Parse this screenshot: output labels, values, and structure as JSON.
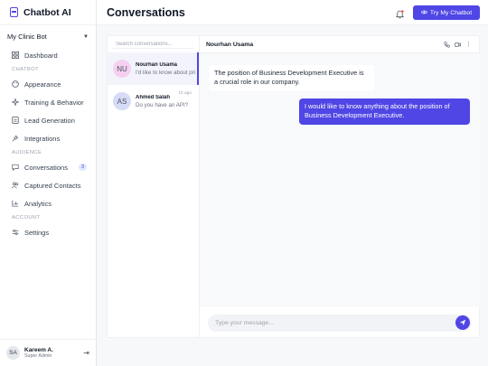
{
  "app": {
    "name": "Chatbot AI",
    "accent": "#4f46e5"
  },
  "sidebar": {
    "bot_select": "My Clinic Bot",
    "dashboard": {
      "label": "Dashboard",
      "icon": "grid-icon"
    },
    "sections": [
      {
        "label": "CHATBOT"
      },
      {
        "label": "AUDIENCE"
      },
      {
        "label": "ACCOUNT"
      }
    ],
    "chatbot_items": [
      {
        "label": "Appearance",
        "icon": "palette-icon"
      },
      {
        "label": "Training & Behavior",
        "icon": "sparkle-icon"
      },
      {
        "label": "Lead Generation",
        "icon": "form-icon"
      },
      {
        "label": "Integrations",
        "icon": "plug-icon"
      }
    ],
    "audience_items": [
      {
        "label": "Conversations",
        "icon": "chat-icon",
        "badge": "3"
      },
      {
        "label": "Captured Contacts",
        "icon": "users-icon"
      },
      {
        "label": "Analytics",
        "icon": "chart-icon"
      }
    ],
    "account_items": [
      {
        "label": "Settings",
        "icon": "sliders-icon"
      }
    ],
    "user": {
      "initials": "SA",
      "name": "Kareem A.",
      "role": "Super Admin"
    }
  },
  "header": {
    "title": "Conversations",
    "try_button": "Try My Chatbot"
  },
  "conversations": {
    "search_placeholder": "Search conversations...",
    "items": [
      {
        "initials": "NU",
        "name": "Nourhan Usama",
        "preview": "I'd like to know about pri",
        "time": "",
        "avatar_color": "#f5d0f0"
      },
      {
        "initials": "AS",
        "name": "Ahmed Salah",
        "preview": "Do you have an API?",
        "time": "1h ago",
        "avatar_color": "#d6dcf5"
      }
    ]
  },
  "chat": {
    "contact": "Nourhan Usama",
    "messages": [
      {
        "from": "bot",
        "text": "The position of Business Development Executive is a crucial role in our company."
      },
      {
        "from": "user",
        "text": "I would like to know anything about the position of Business Development Executive."
      }
    ],
    "composer_placeholder": "Type your message..."
  }
}
